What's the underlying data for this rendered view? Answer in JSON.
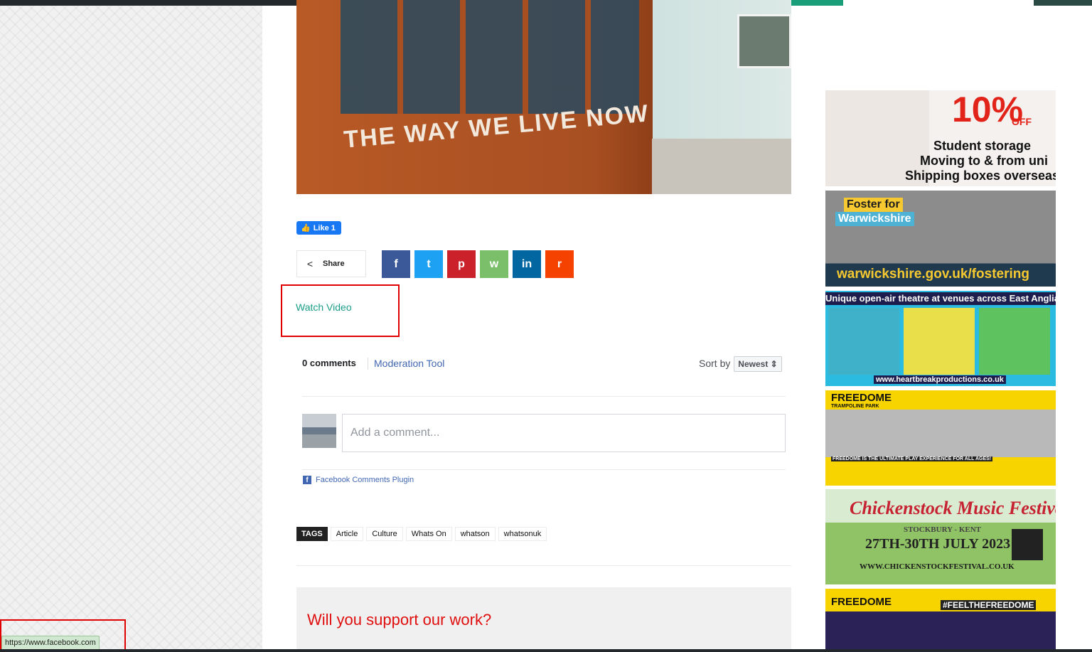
{
  "article": {
    "hero_text": "THE WAY WE LIVE NOW"
  },
  "facebook_like": {
    "label": "Like 1"
  },
  "share": {
    "label": "Share",
    "buttons": [
      {
        "name": "facebook",
        "glyph": "f",
        "color": "#3b5998"
      },
      {
        "name": "twitter",
        "glyph": "t",
        "color": "#1da1f2"
      },
      {
        "name": "pinterest",
        "glyph": "p",
        "color": "#ca212a"
      },
      {
        "name": "whatsapp",
        "glyph": "w",
        "color": "#7bbf6a"
      },
      {
        "name": "linkedin",
        "glyph": "in",
        "color": "#0266a0"
      },
      {
        "name": "reddit",
        "glyph": "r",
        "color": "#f54200"
      }
    ]
  },
  "watch_video": "Watch Video",
  "comments": {
    "count_label": "0 comments",
    "moderation": "Moderation Tool",
    "sort_label": "Sort by",
    "sort_value": "Newest ⇕",
    "placeholder": "Add a comment...",
    "plugin_label": "Facebook Comments Plugin"
  },
  "tags": {
    "heading": "TAGS",
    "items": [
      "Article",
      "Culture",
      "Whats On",
      "whatson",
      "whatsonuk"
    ]
  },
  "support": {
    "heading": "Will you support our work?"
  },
  "ads": [
    {
      "name": "storage",
      "lines": [
        "10%",
        "OFF",
        "Student storage",
        "Moving to & from uni",
        "Shipping boxes overseas"
      ]
    },
    {
      "name": "fostering",
      "lines": [
        "Foster for",
        "Warwickshire",
        "warwickshire.gov.uk/fostering"
      ]
    },
    {
      "name": "theatre",
      "lines": [
        "Unique open-air theatre at venues across East Anglia",
        "www.heartbreakproductions.co.uk"
      ]
    },
    {
      "name": "freedome",
      "lines": [
        "FREEDOME",
        "TRAMPOLINE PARK",
        "FREEDOME IS THE ULTIMATE PLAY EXPERIENCE FOR ALL AGES!"
      ]
    },
    {
      "name": "chickenstock",
      "lines": [
        "Chickenstock Music Festival",
        "STOCKBURY - KENT",
        "27TH-30TH JULY 2023",
        "WWW.CHICKENSTOCKFESTIVAL.CO.UK"
      ]
    },
    {
      "name": "freedome2",
      "lines": [
        "FREEDOME",
        "#FEELTHEFREEDOME"
      ]
    }
  ],
  "status_url": "https://www.facebook.com",
  "colors": {
    "accent": "#1a9e87",
    "highlight": "#e00000",
    "support_red": "#e00f0f"
  }
}
